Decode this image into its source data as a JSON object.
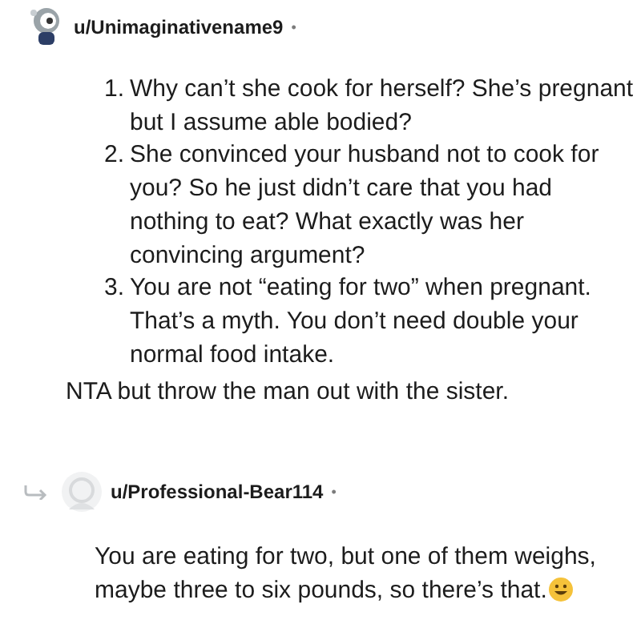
{
  "comments": [
    {
      "username": "u/Unimaginativename9",
      "separator": "•",
      "kind": "top",
      "list": [
        {
          "number": "1.",
          "text": "Why can’t she cook for herself? She’s pregnant but I assume able bodied?"
        },
        {
          "number": "2.",
          "text": "She convinced your husband not to cook for you? So he just didn’t care that you had nothing to eat? What exactly was her convincing argument?"
        },
        {
          "number": "3.",
          "text": "You are not “eating for two” when pregnant. That’s a myth. You don’t need double your normal food intake."
        }
      ],
      "paragraphs": [
        "NTA but throw the man out with the sister."
      ]
    },
    {
      "username": "u/Professional-Bear114",
      "separator": "•",
      "kind": "reply",
      "paragraphs": [
        "You are eating for two, but one of them weighs, maybe three to six pounds, so there’s that."
      ],
      "end_icon": {
        "kind": "smiley"
      }
    }
  ]
}
